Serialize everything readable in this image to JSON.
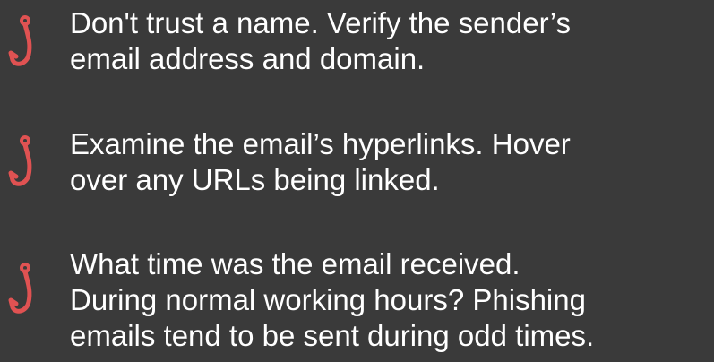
{
  "colors": {
    "background": "#3a3a3a",
    "text": "#ffffff",
    "hook": "#e05252"
  },
  "tips": [
    {
      "icon": "fish-hook-icon",
      "lines": [
        "Don't trust a name. Verify the sender’s",
        "email address and domain."
      ]
    },
    {
      "icon": "fish-hook-icon",
      "lines": [
        "Examine the email’s hyperlinks. Hover",
        "over any URLs being linked."
      ]
    },
    {
      "icon": "fish-hook-icon",
      "lines": [
        "What time was the email received.",
        "During normal working hours? Phishing",
        "emails tend to be sent during odd times."
      ]
    }
  ]
}
